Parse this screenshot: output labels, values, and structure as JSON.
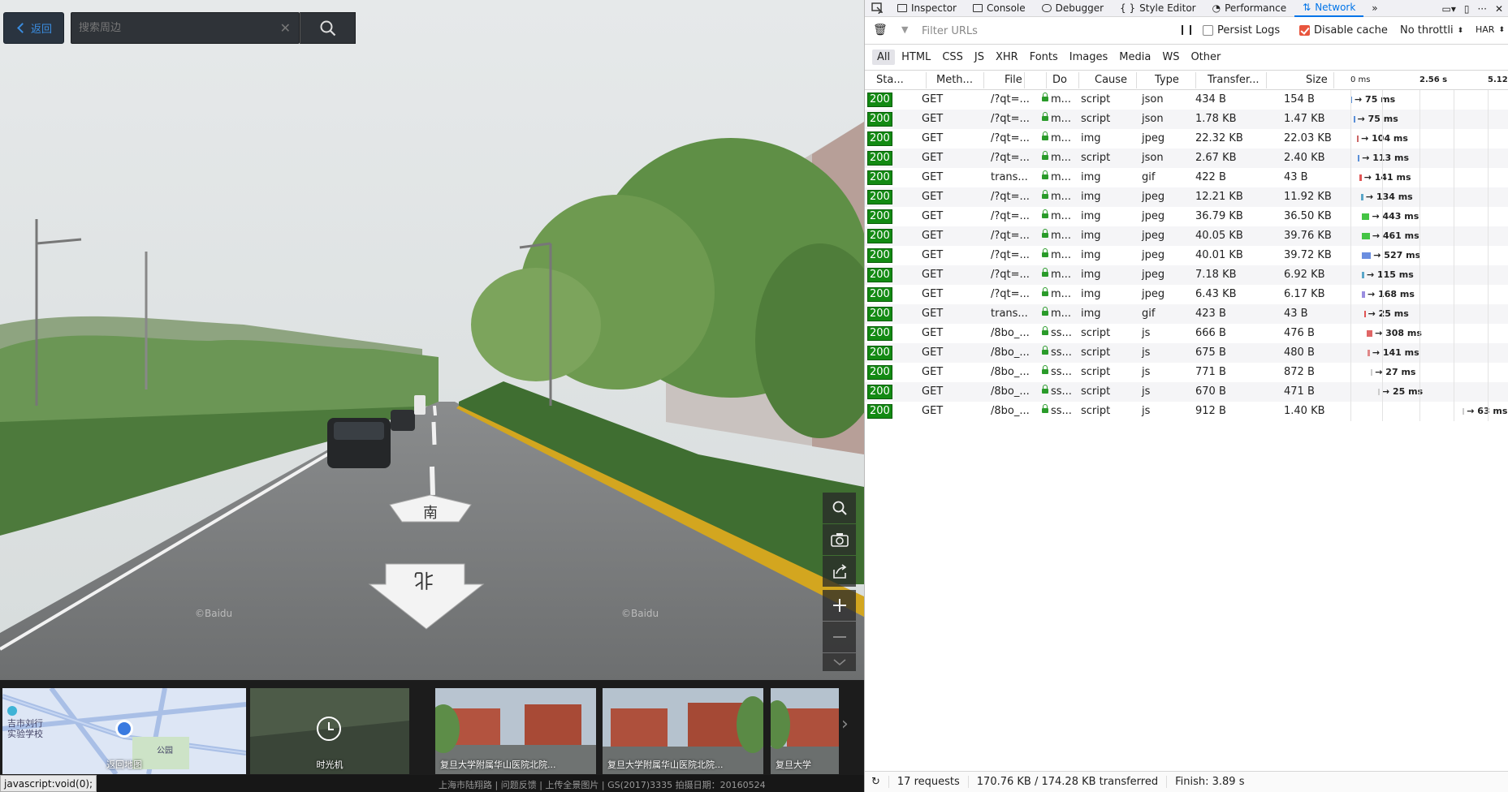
{
  "pano": {
    "back_label": "返回",
    "search_placeholder": "搜索周边",
    "thumbs": [
      {
        "label": "返回地图",
        "place": "吉市刘行\n实验学校",
        "park": "公园"
      },
      {
        "label": "时光机"
      },
      {
        "label": "复旦大学附属华山医院北院..."
      },
      {
        "label": "复旦大学附属华山医院北院..."
      },
      {
        "label": "复旦大学"
      }
    ],
    "watermark": "©Baidu",
    "status_url": "javascript:void(0);",
    "footer": "上海市陆翔路  |  问题反馈  |  上传全景图片  |  GS(2017)3335  拍摄日期：20160524"
  },
  "devtools": {
    "tabs": [
      "Inspector",
      "Console",
      "Debugger",
      "Style Editor",
      "Performance",
      "Network"
    ],
    "active_tab": "Network",
    "filter_placeholder": "Filter URLs",
    "persist_logs": "Persist Logs",
    "disable_cache": "Disable cache",
    "throttle": "No throttli",
    "har": "HAR",
    "type_filters": [
      "All",
      "HTML",
      "CSS",
      "JS",
      "XHR",
      "Fonts",
      "Images",
      "Media",
      "WS",
      "Other"
    ],
    "columns": [
      "Sta...",
      "Meth...",
      "File",
      "Do",
      "Cause",
      "Type",
      "Transfer...",
      "Size"
    ],
    "timeline_ticks": [
      "0 ms",
      "2.56 s",
      "5.12"
    ],
    "requests": [
      {
        "status": "200",
        "method": "GET",
        "file": "/?qt=...",
        "domain": "m...",
        "cause": "script",
        "type": "json",
        "transferred": "434 B",
        "size": "154 B",
        "time": "→ 75 ms",
        "start": 0.0,
        "dur": 0.004,
        "color": "#5a8fd8"
      },
      {
        "status": "200",
        "method": "GET",
        "file": "/?qt=...",
        "domain": "m...",
        "cause": "script",
        "type": "json",
        "transferred": "1.78 KB",
        "size": "1.47 KB",
        "time": "→ 75 ms",
        "start": 0.01,
        "dur": 0.004,
        "color": "#5a8fd8"
      },
      {
        "status": "200",
        "method": "GET",
        "file": "/?qt=...",
        "domain": "m...",
        "cause": "img",
        "type": "jpeg",
        "transferred": "22.32 KB",
        "size": "22.03 KB",
        "time": "→ 104 ms",
        "start": 0.022,
        "dur": 0.006,
        "color": "#cc6666"
      },
      {
        "status": "200",
        "method": "GET",
        "file": "/?qt=...",
        "domain": "m...",
        "cause": "script",
        "type": "json",
        "transferred": "2.67 KB",
        "size": "2.40 KB",
        "time": "→ 113 ms",
        "start": 0.024,
        "dur": 0.007,
        "color": "#5a8fd8"
      },
      {
        "status": "200",
        "method": "GET",
        "file": "trans...",
        "domain": "m...",
        "cause": "img",
        "type": "gif",
        "transferred": "422 B",
        "size": "43 B",
        "time": "→ 141 ms",
        "start": 0.03,
        "dur": 0.008,
        "color": "#e05555"
      },
      {
        "status": "200",
        "method": "GET",
        "file": "/?qt=...",
        "domain": "m...",
        "cause": "img",
        "type": "jpeg",
        "transferred": "12.21 KB",
        "size": "11.92 KB",
        "time": "→ 134 ms",
        "start": 0.036,
        "dur": 0.008,
        "color": "#5aa6c8"
      },
      {
        "status": "200",
        "method": "GET",
        "file": "/?qt=...",
        "domain": "m...",
        "cause": "img",
        "type": "jpeg",
        "transferred": "36.79 KB",
        "size": "36.50 KB",
        "time": "→ 443 ms",
        "start": 0.038,
        "dur": 0.027,
        "color": "#44c444"
      },
      {
        "status": "200",
        "method": "GET",
        "file": "/?qt=...",
        "domain": "m...",
        "cause": "img",
        "type": "jpeg",
        "transferred": "40.05 KB",
        "size": "39.76 KB",
        "time": "→ 461 ms",
        "start": 0.038,
        "dur": 0.028,
        "color": "#44c444"
      },
      {
        "status": "200",
        "method": "GET",
        "file": "/?qt=...",
        "domain": "m...",
        "cause": "img",
        "type": "jpeg",
        "transferred": "40.01 KB",
        "size": "39.72 KB",
        "time": "→ 527 ms",
        "start": 0.038,
        "dur": 0.032,
        "color": "#6b8ee0"
      },
      {
        "status": "200",
        "method": "GET",
        "file": "/?qt=...",
        "domain": "m...",
        "cause": "img",
        "type": "jpeg",
        "transferred": "7.18 KB",
        "size": "6.92 KB",
        "time": "→ 115 ms",
        "start": 0.04,
        "dur": 0.007,
        "color": "#5aa6c8"
      },
      {
        "status": "200",
        "method": "GET",
        "file": "/?qt=...",
        "domain": "m...",
        "cause": "img",
        "type": "jpeg",
        "transferred": "6.43 KB",
        "size": "6.17 KB",
        "time": "→ 168 ms",
        "start": 0.04,
        "dur": 0.01,
        "color": "#9a8ee0"
      },
      {
        "status": "200",
        "method": "GET",
        "file": "trans...",
        "domain": "m...",
        "cause": "img",
        "type": "gif",
        "transferred": "423 B",
        "size": "43 B",
        "time": "→ 25 ms",
        "start": 0.046,
        "dur": 0.002,
        "color": "#e05555"
      },
      {
        "status": "200",
        "method": "GET",
        "file": "/8bo_...",
        "domain": "ss...",
        "cause": "script",
        "type": "js",
        "transferred": "666 B",
        "size": "476 B",
        "time": "→ 308 ms",
        "start": 0.056,
        "dur": 0.019,
        "color": "#e06666"
      },
      {
        "status": "200",
        "method": "GET",
        "file": "/8bo_...",
        "domain": "ss...",
        "cause": "script",
        "type": "js",
        "transferred": "675 B",
        "size": "480 B",
        "time": "→ 141 ms",
        "start": 0.058,
        "dur": 0.008,
        "color": "#e08888"
      },
      {
        "status": "200",
        "method": "GET",
        "file": "/8bo_...",
        "domain": "ss...",
        "cause": "script",
        "type": "js",
        "transferred": "771 B",
        "size": "872 B",
        "time": "→ 27 ms",
        "start": 0.07,
        "dur": 0.002,
        "color": "#cccccc"
      },
      {
        "status": "200",
        "method": "GET",
        "file": "/8bo_...",
        "domain": "ss...",
        "cause": "script",
        "type": "js",
        "transferred": "670 B",
        "size": "471 B",
        "time": "→ 25 ms",
        "start": 0.094,
        "dur": 0.002,
        "color": "#cccccc"
      },
      {
        "status": "200",
        "method": "GET",
        "file": "/8bo_...",
        "domain": "ss...",
        "cause": "script",
        "type": "js",
        "transferred": "912 B",
        "size": "1.40 KB",
        "time": "→ 63 ms",
        "start": 0.383,
        "dur": 0.004,
        "color": "#cccccc"
      }
    ],
    "summary_requests": "17 requests",
    "summary_size": "170.76 KB / 174.28 KB transferred",
    "summary_finish": "Finish: 3.89 s"
  }
}
